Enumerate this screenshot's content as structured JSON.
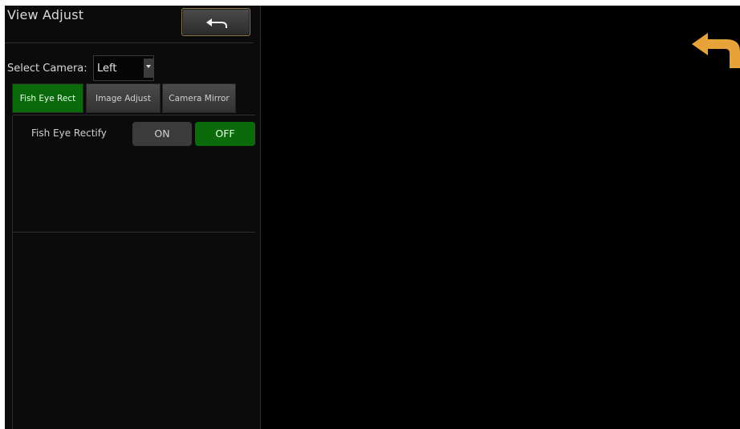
{
  "header": {
    "title": "View Adjust"
  },
  "camera_select": {
    "label": "Select Camera:",
    "value": "Left"
  },
  "tabs": [
    {
      "label": "Fish Eye Rect",
      "active": true
    },
    {
      "label": "Image Adjust",
      "active": false
    },
    {
      "label": "Camera Mirror",
      "active": false
    }
  ],
  "fish_eye": {
    "label": "Fish Eye Rectify",
    "on_label": "ON",
    "off_label": "OFF",
    "selected": "OFF"
  },
  "icons": {
    "back": "back-arrow-icon",
    "overlay": "back-arrow-icon",
    "dropdown": "chevron-down-icon"
  },
  "colors": {
    "active_green": "#0a690a",
    "accent_orange": "#e8a23a",
    "background": "#000000"
  }
}
